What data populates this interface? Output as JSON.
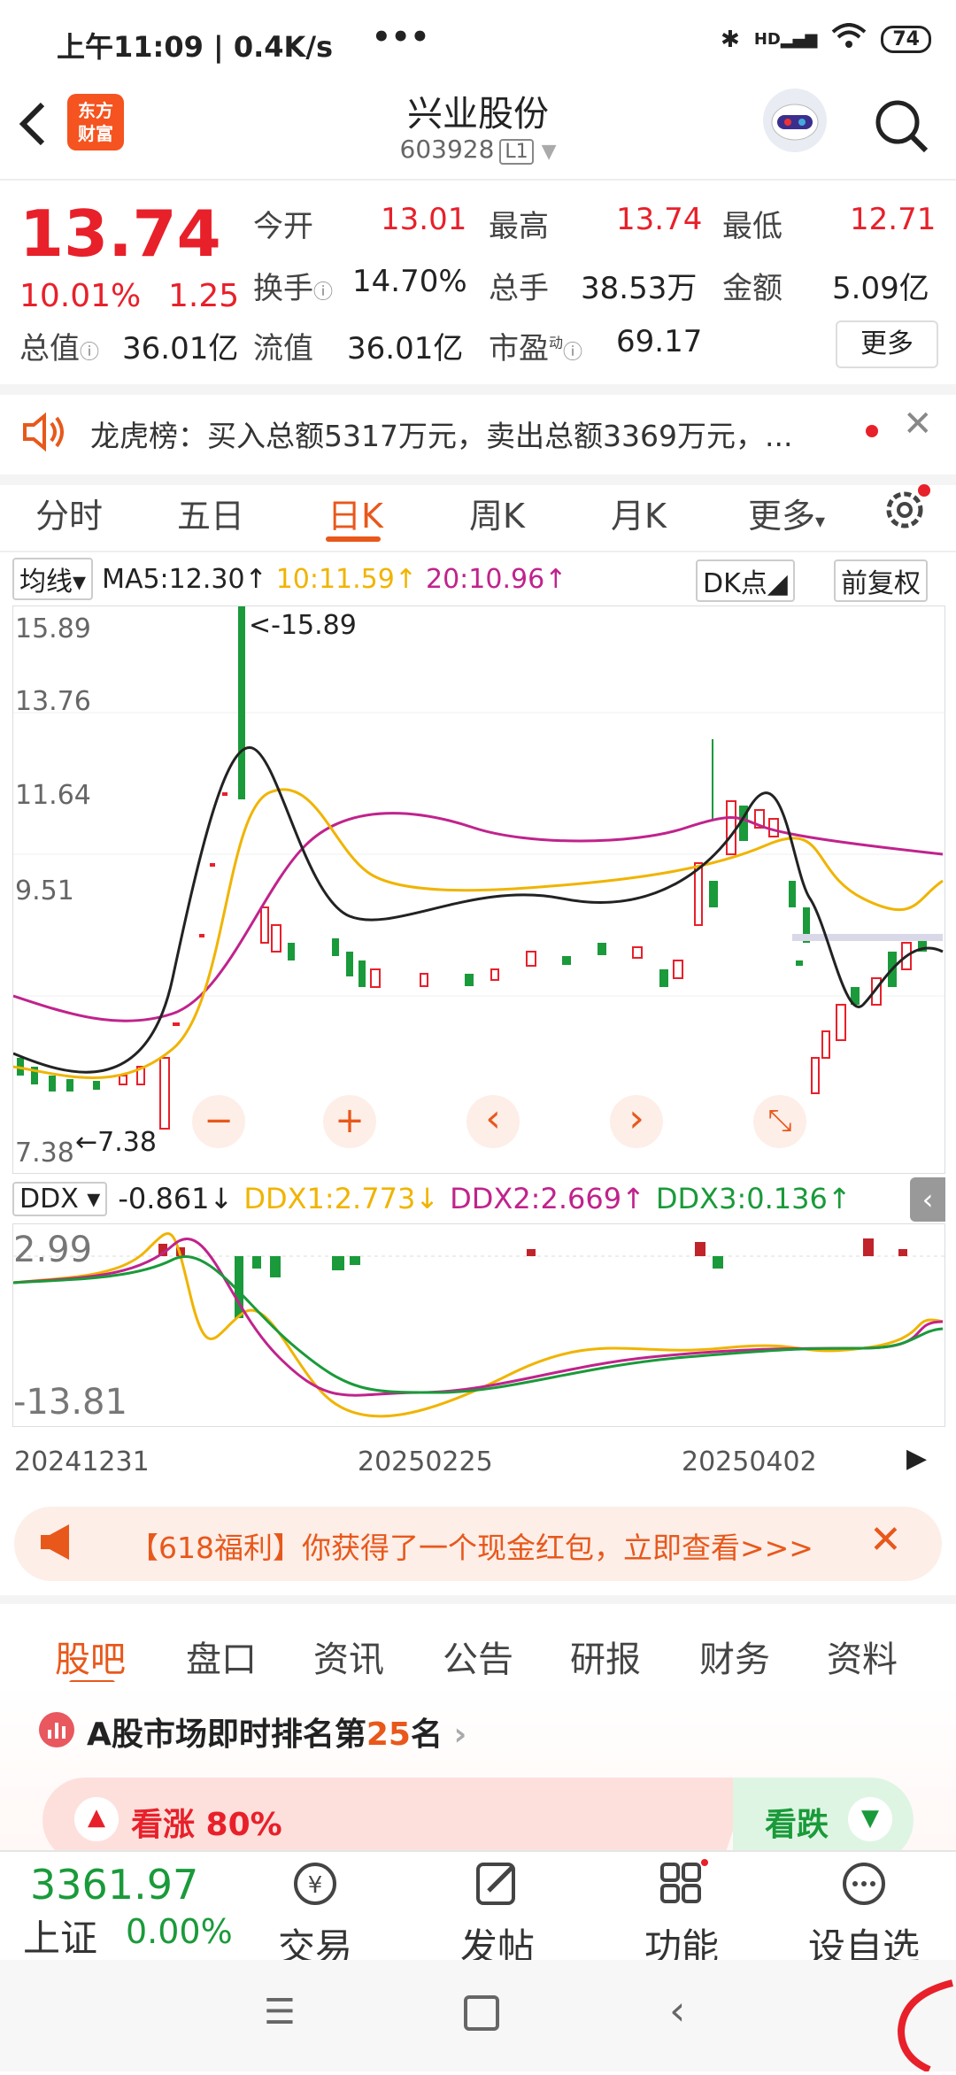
{
  "status_bar": {
    "time": "上午11:09 | 0.4K/s",
    "dots": "•••",
    "battery": "74",
    "hd": "HD"
  },
  "header": {
    "logo_line1": "东方",
    "logo_line2": "财富",
    "title": "兴业股份",
    "code": "603928",
    "level": "L1"
  },
  "quote": {
    "price": "13.74",
    "pct": "10.01%",
    "change": "1.25",
    "open_label": "今开",
    "open": "13.01",
    "high_label": "最高",
    "high": "13.74",
    "low_label": "最低",
    "low": "12.71",
    "turnover_label": "换手",
    "turnover": "14.70%",
    "volume_label": "总手",
    "volume": "38.53万",
    "amount_label": "金额",
    "amount": "5.09亿",
    "mcap_label": "总值",
    "mcap": "36.01亿",
    "float_label": "流值",
    "float": "36.01亿",
    "pe_label": "市盈",
    "pe_sup": "动",
    "pe": "69.17",
    "more": "更多"
  },
  "notice": {
    "text": "龙虎榜：买入总额5317万元，卖出总额3369万元，..."
  },
  "tabs": [
    "分时",
    "五日",
    "日K",
    "周K",
    "月K",
    "更多"
  ],
  "ma_bar": {
    "selector": "均线",
    "ma5": "MA5:12.30",
    "ma10": "10:11.59",
    "ma20": "20:10.96",
    "dk": "DK点",
    "adjust": "前复权",
    "colors": {
      "ma5": "#222222",
      "ma10": "#f0b400",
      "ma20": "#c0238c"
    }
  },
  "kline": {
    "y_labels": [
      "15.89",
      "13.76",
      "11.64",
      "9.51",
      "7.38"
    ],
    "max_marker": "<-15.89",
    "min_marker": "7.38",
    "controls": [
      "−",
      "+",
      "‹",
      "›",
      "⤡"
    ]
  },
  "ddx_bar": {
    "selector": "DDX",
    "ddx": "-0.861",
    "ddx1": "DDX1:2.773",
    "ddx2": "DDX2:2.669",
    "ddx3": "DDX3:0.136"
  },
  "ddx_chart": {
    "y_labels": [
      "2.99",
      "-13.81"
    ]
  },
  "dates": [
    "20241231",
    "20250225",
    "20250402"
  ],
  "promo": {
    "text": "【618福利】你获得了一个现金红包，立即查看>>>"
  },
  "section_tabs": [
    "股吧",
    "盘口",
    "资讯",
    "公告",
    "研报",
    "财务",
    "资料"
  ],
  "ranking": {
    "prefix": "A股市场即时排名第",
    "rank": "25",
    "suffix": "名"
  },
  "vote": {
    "up": "看涨 80%",
    "down": "看跌"
  },
  "dock": {
    "index_value": "3361.97",
    "index_name": "上证",
    "index_change": "0.00%",
    "items": [
      "交易",
      "发帖",
      "功能",
      "设自选"
    ]
  }
}
